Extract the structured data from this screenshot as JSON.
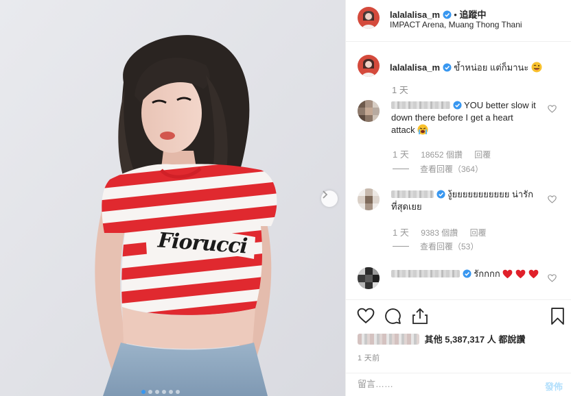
{
  "post": {
    "username": "lalalalisa_m",
    "follow_separator": "•",
    "follow_label": "追蹤中",
    "location": "IMPACT Arena, Muang Thong Thani",
    "photo_print_text": "Fiorucci"
  },
  "caption": {
    "username": "lalalalisa_m",
    "text": "ข้ำหน่อย แต่ก็มานะ",
    "emoji": "tongue-wink-emoji",
    "time": "1 天"
  },
  "comments": [
    {
      "text": "YOU better slow it down there before I get a heart attack",
      "emoji": "crying-emoji",
      "time": "1 天",
      "likes": "18652 個讚",
      "reply_label": "回覆",
      "view_replies": "查看回覆（364）"
    },
    {
      "text": "งู้ยยยยยยยยยยย น่ารักที่สุดเยย",
      "time": "1 天",
      "likes": "9383 個讚",
      "reply_label": "回覆",
      "view_replies": "查看回覆（53）"
    },
    {
      "text": "รักกกก",
      "emoji": "red-heart-emoji"
    }
  ],
  "likes": {
    "text_prefix": "其他",
    "count": "5,387,317",
    "text_suffix": "人 都說讚"
  },
  "post_time": "1 天前",
  "add_comment": {
    "placeholder": "留言……",
    "post_label": "發佈"
  },
  "colors": {
    "verified_blue": "#3897f0",
    "heart_red": "#ed4956",
    "shirt_red": "#e0292f"
  }
}
